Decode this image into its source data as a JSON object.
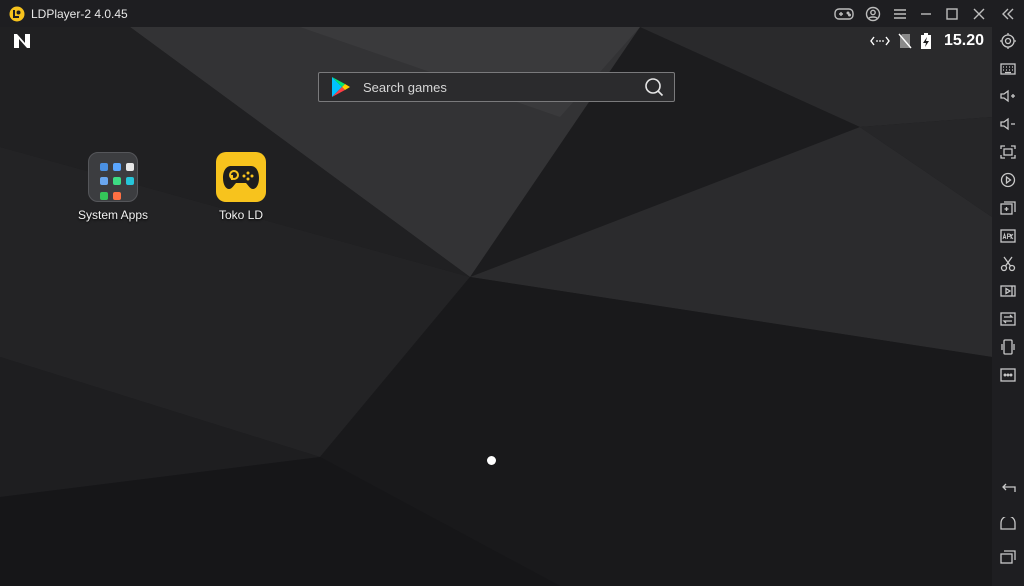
{
  "window": {
    "title": "LDPlayer-2 4.0.45",
    "controls": [
      "gamepad-icon",
      "account-icon",
      "menu-icon",
      "minimize-icon",
      "maximize-icon",
      "close-icon",
      "collapse-sidebar-icon"
    ]
  },
  "status_bar": {
    "time": "15.20",
    "icons": [
      "launcher-n-icon",
      "data-transfer-icon",
      "no-sim-icon",
      "battery-charging-icon"
    ]
  },
  "search": {
    "placeholder": "Search games"
  },
  "desktop": {
    "apps": [
      {
        "label": "System Apps",
        "icon": "system-apps-folder-icon"
      },
      {
        "label": "Toko LD",
        "icon": "toko-ld-gamepad-icon"
      }
    ],
    "page_indicator": {
      "current": 1,
      "total": 1
    }
  },
  "sidebar": {
    "tools": [
      "settings-icon",
      "keyboard-mapping-icon",
      "volume-up-icon",
      "volume-down-icon",
      "fullscreen-icon",
      "screen-record-icon",
      "add-instance-icon",
      "install-apk-icon",
      "screenshot-icon",
      "video-icon",
      "sync-icon",
      "shake-icon",
      "more-icon"
    ],
    "nav": [
      "back-icon",
      "home-icon",
      "recent-apps-icon"
    ]
  },
  "colors": {
    "accent": "#f7c31d",
    "titlebar": "#1e1e21",
    "wallpaper": "#1c1c1e"
  }
}
